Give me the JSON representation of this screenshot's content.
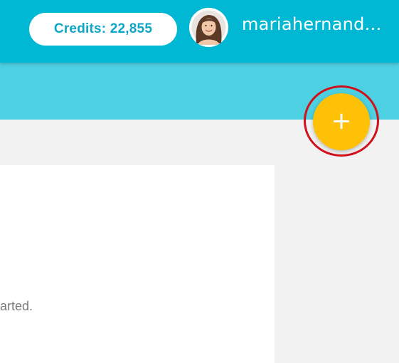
{
  "header": {
    "credits_label": "Credits: 22,855",
    "username": "mariahernand..."
  },
  "avatar": {
    "icon": "user-avatar-photo"
  },
  "fab": {
    "label": "+",
    "icon": "plus-icon",
    "color": "#ffc107"
  },
  "content": {
    "partial_text": "arted."
  },
  "colors": {
    "header": "#00b8d4",
    "subheader": "#4dd0e1",
    "accent": "#ffc107",
    "highlight": "#d0101a"
  }
}
